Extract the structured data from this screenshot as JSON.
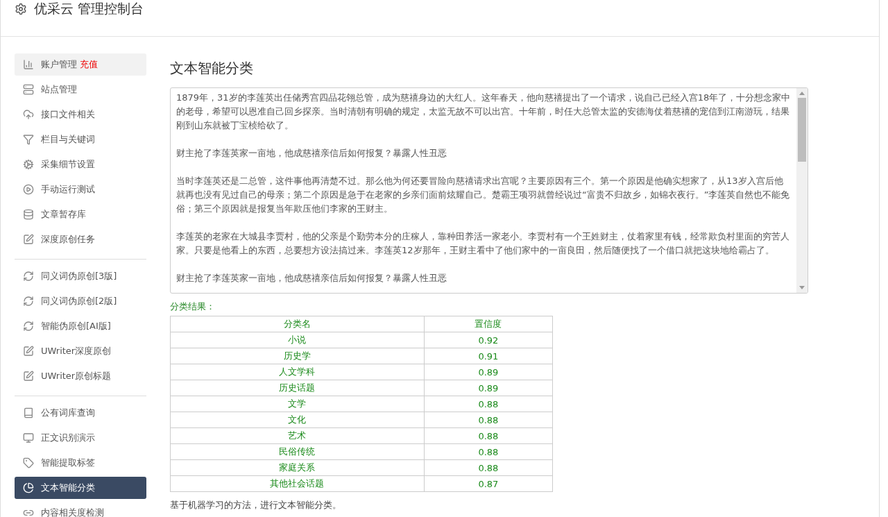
{
  "header": {
    "title": "优采云 管理控制台"
  },
  "sidebar": {
    "groups": [
      {
        "items": [
          {
            "label": "账户管理",
            "badge": "充值",
            "selected": false
          },
          {
            "label": "站点管理",
            "selected": false
          },
          {
            "label": "接口文件相关",
            "selected": false
          },
          {
            "label": "栏目与关键词",
            "selected": false
          },
          {
            "label": "采集细节设置",
            "selected": false
          },
          {
            "label": "手动运行测试",
            "selected": false
          },
          {
            "label": "文章暂存库",
            "selected": false
          },
          {
            "label": "深度原创任务",
            "selected": false
          }
        ]
      },
      {
        "items": [
          {
            "label": "同义词伪原创[3版]",
            "selected": false
          },
          {
            "label": "同义词伪原创[2版]",
            "selected": false
          },
          {
            "label": "智能伪原创[AI版]",
            "selected": false
          },
          {
            "label": "UWriter深度原创",
            "selected": false
          },
          {
            "label": "UWriter原创标题",
            "selected": false
          }
        ]
      },
      {
        "items": [
          {
            "label": "公有词库查询",
            "selected": false
          },
          {
            "label": "正文识别演示",
            "selected": false
          },
          {
            "label": "智能提取标签",
            "selected": false
          },
          {
            "label": "文本智能分类",
            "selected": true
          },
          {
            "label": "内容相关度检测",
            "selected": false
          }
        ]
      }
    ]
  },
  "main": {
    "title": "文本智能分类",
    "text_input": {
      "paragraphs": [
        "1879年，31岁的李莲英出任储秀宫四品花翎总管，成为慈禧身边的大红人。这年春天，他向慈禧提出了一个请求，说自己已经入宫18年了，十分想念家中的老母，希望可以恩准自己回乡探亲。当时清朝有明确的规定，太监无故不可以出宫。十年前，时任大总管太监的安德海仗着慈禧的宠信到江南游玩，结果刚到山东就被丁宝桢给砍了。",
        "财主抢了李莲英家一亩地，他成慈禧亲信后如何报复？暴露人性丑恶",
        "当时李莲英还是二总管，这件事他再清楚不过。那么他为何还要冒险向慈禧请求出宫呢？主要原因有三个。第一个原因是他确实想家了，从13岁入宫后他就再也没有见过自己的母亲；第二个原因是急于在老家的乡亲们面前炫耀自己。楚霸王项羽就曾经说过“富贵不归故乡，如锦衣夜行。”李莲英自然也不能免俗；第三个原因就是报复当年欺压他们李家的王财主。",
        "李莲英的老家在大城县李贾村，他的父亲是个勤劳本分的庄稼人，靠种田养活一家老小。李贾村有一个王姓财主，仗着家里有钱，经常欺负村里面的穷苦人家。只要是他看上的东西，总要想方设法搞过来。李莲英12岁那年，王财主看中了他们家中的一亩良田，然后随便找了一个借口就把这块地给霸占了。",
        "财主抢了李莲英家一亩地，他成慈禧亲信后如何报复？暴露人性丑恶"
      ]
    },
    "result_label": "分类结果：",
    "table": {
      "columns": [
        "分类名",
        "置信度"
      ],
      "rows": [
        [
          "小说",
          "0.92"
        ],
        [
          "历史学",
          "0.91"
        ],
        [
          "人文学科",
          "0.89"
        ],
        [
          "历史话题",
          "0.89"
        ],
        [
          "文学",
          "0.88"
        ],
        [
          "文化",
          "0.88"
        ],
        [
          "艺术",
          "0.88"
        ],
        [
          "民俗传统",
          "0.88"
        ],
        [
          "家庭关系",
          "0.88"
        ],
        [
          "其他社会话题",
          "0.87"
        ]
      ]
    },
    "note": "基于机器学习的方法，进行文本智能分类。"
  }
}
